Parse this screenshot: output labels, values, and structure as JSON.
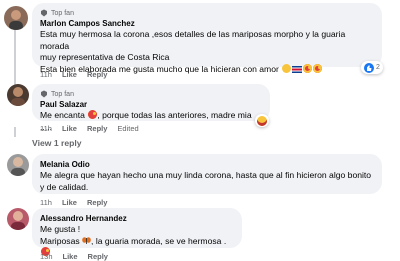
{
  "comments": [
    {
      "badge": "Top fan",
      "author": "Marlon Campos Sanchez",
      "lines": [
        "Esta muy hermosa la corona ,esos detalles de las mariposas morpho y la guaria morada",
        "muy representativa de Costa Rica",
        "Esta bien elaborada me gusta mucho que la hicieran con amor"
      ],
      "time": "11h",
      "like": "Like",
      "reply": "Reply",
      "reactions_count": "2"
    },
    {
      "badge": "Top fan",
      "author": "Paul Salazar",
      "lines": [
        "Me encanta",
        ", porque todas las anteriores, madre mia ....."
      ],
      "time": "11h",
      "like": "Like",
      "reply": "Reply",
      "edited": "Edited"
    },
    {
      "view_reply": "View 1 reply"
    },
    {
      "author": "Melania Odio",
      "lines": [
        "Me alegra que hayan hecho una muy linda corona, hasta que al fin hicieron algo bonito",
        "y de calidad."
      ],
      "time": "11h",
      "like": "Like",
      "reply": "Reply"
    },
    {
      "author": "Alessandro Hernandez",
      "lines": [
        "Me gusta !",
        "Mariposas",
        ", la guaria morada, se ve hermosa ."
      ],
      "time": "13h",
      "like": "Like",
      "reply": "Reply"
    }
  ],
  "colors": {
    "bubble": "#f0f2f5",
    "meta_text": "#65676b",
    "like_blue": "#1877f2",
    "love_red": "#f33e58"
  }
}
